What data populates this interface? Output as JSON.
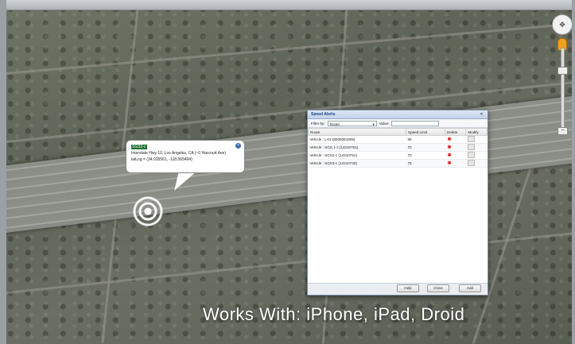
{
  "map": {
    "bubble": {
      "highlight": "SGS3-c",
      "address": "Interstate Hwy 10, Los Angeles, CA (~0 Harcourt Ave)",
      "latlng": "latLng = (34.035561, -118.365494)",
      "close_icon": "close-icon"
    },
    "nav": {
      "pan_icon": "pan-control-icon",
      "zoom_in": "+",
      "zoom_out": "−"
    }
  },
  "dialog": {
    "title": "Speed Alerts",
    "filter_label": "Filter by:",
    "filter_select": "Route",
    "filter_value_label": "Value:",
    "filter_value": "",
    "columns": [
      "Route",
      "Speed Limit",
      "Delete",
      "Modify"
    ],
    "rows": [
      {
        "route": "Vehicle : LH1 (8008061809)",
        "speed": "65"
      },
      {
        "route": "Vehicle : SGS 1-J (14310751)",
        "speed": "70"
      },
      {
        "route": "Vehicle : SGS2-c (14310751)",
        "speed": "70"
      },
      {
        "route": "Vehicle : SGS3-c (14310730)",
        "speed": "75"
      }
    ],
    "buttons": {
      "help": "Help",
      "close": "Close",
      "add": "Add"
    }
  },
  "tagline": "Works With:  iPhone, iPad, Droid"
}
